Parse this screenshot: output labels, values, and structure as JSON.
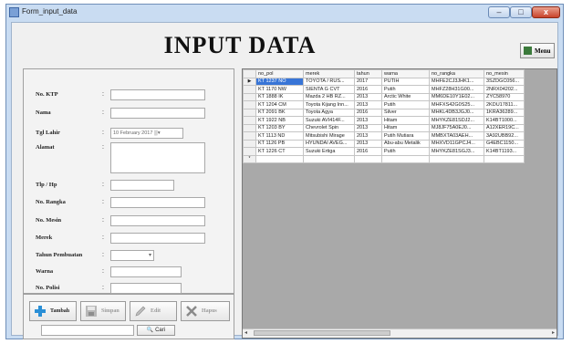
{
  "window": {
    "title": "Form_input_data",
    "min_label": "–",
    "max_label": "□",
    "close_label": "x"
  },
  "page": {
    "heading": "INPUT DATA"
  },
  "menu_button": {
    "label": "Menu"
  },
  "form": {
    "fields": [
      {
        "label": "No. KTP",
        "colon": ":"
      },
      {
        "label": "Nama",
        "colon": ":"
      },
      {
        "label": "Tgl Lahir",
        "colon": ":",
        "date_value": "10 February 2017  ▒▾"
      },
      {
        "label": "Alamat",
        "colon": ":"
      },
      {
        "label": "Tlp / Hp",
        "colon": ":"
      },
      {
        "label": "No. Rangka",
        "colon": ":"
      },
      {
        "label": "No. Mesin",
        "colon": ":"
      },
      {
        "label": "Merek",
        "colon": ":"
      },
      {
        "label": "Tahun Pembuatan",
        "colon": ":"
      },
      {
        "label": "Warna",
        "colon": ":"
      },
      {
        "label": "No. Polisi",
        "colon": ":"
      }
    ]
  },
  "buttons": {
    "tambah": "Tambah",
    "simpan": "Simpan",
    "edit": "Edit",
    "hapus": "Hapus",
    "cari": "Cari"
  },
  "table": {
    "columns": [
      "no_pol",
      "merek",
      "tahun",
      "warna",
      "no_rangka",
      "no_mesin"
    ],
    "rows": [
      [
        "KT 1237 NO",
        "TOYOTA / RUS...",
        "2017",
        "PUTIH",
        "MHFE2CJ3JHK1...",
        "3SZDGC056..."
      ],
      [
        "KT 1170 NW",
        "SIENTA G CVT",
        "2016",
        "Putih",
        "MHFZ28H31G00...",
        "2NRX04202..."
      ],
      [
        "KT 1888 IK",
        "Mazda 2 HB RZ...",
        "2013",
        "Arctic White",
        "MM6DE10Y1E02...",
        "ZYC58970"
      ],
      [
        "KT 1204 CM",
        "Toyota Kijang Inn...",
        "2013",
        "Putih",
        "MHFXS42G0S25...",
        "2KDU17811..."
      ],
      [
        "KT 2091 BK",
        "Toyota Agya",
        "2016",
        "Silver",
        "MHKL4DB3JGJ0...",
        "1KRA36289..."
      ],
      [
        "KT 1922 NB",
        "Suzuki AVI414F...",
        "2013",
        "Hitam",
        "MHYKZE81SDJ2...",
        "K14BT1000..."
      ],
      [
        "KT 1203 BY",
        "Chevrolet Spin",
        "2013",
        "Hitam",
        "MJ8JF75A0EJ0...",
        "A12XER19C..."
      ],
      [
        "KT 1113 ND",
        "Mitsubishi Mirage",
        "2013",
        "Putih Mutiara",
        "MMBXTA03AEH...",
        "3A92UBB92..."
      ],
      [
        "KT 1126 PB",
        "HYUNDAI AVEG...",
        "2013",
        "Abu-abu Metalik",
        "MHXVD11GPCJ4...",
        "G4EBC1150..."
      ],
      [
        "KT 1226 CT",
        "Suzuki Ertiga",
        "2016",
        "Putih",
        "MHYKZE81SGJ3...",
        "K14BT1193..."
      ]
    ],
    "current_row_marker": "▶",
    "new_row_marker": "*"
  }
}
